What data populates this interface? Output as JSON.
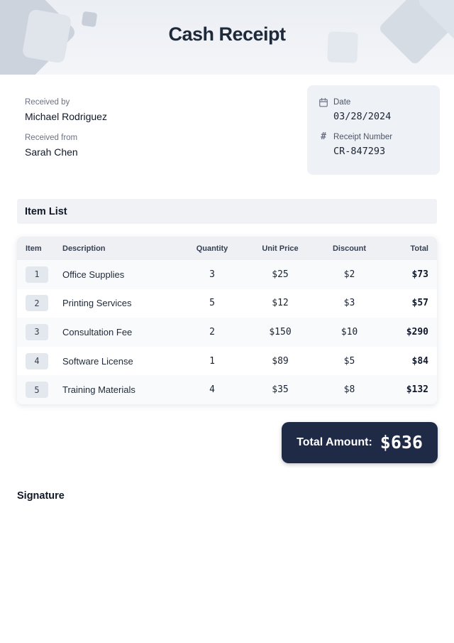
{
  "header": {
    "title": "Cash Receipt"
  },
  "info": {
    "received_by_label": "Received by",
    "received_by": "Michael Rodriguez",
    "received_from_label": "Received from",
    "received_from": "Sarah Chen",
    "date_label": "Date",
    "date": "03/28/2024",
    "receipt_number_label": "Receipt Number",
    "receipt_number": "CR-847293"
  },
  "item_list": {
    "section_title": "Item List",
    "columns": [
      "Item",
      "Description",
      "Quantity",
      "Unit Price",
      "Discount",
      "Total"
    ],
    "rows": [
      {
        "item": "1",
        "description": "Office Supplies",
        "quantity": "3",
        "unit_price": "$25",
        "discount": "$2",
        "total": "$73"
      },
      {
        "item": "2",
        "description": "Printing Services",
        "quantity": "5",
        "unit_price": "$12",
        "discount": "$3",
        "total": "$57"
      },
      {
        "item": "3",
        "description": "Consultation Fee",
        "quantity": "2",
        "unit_price": "$150",
        "discount": "$10",
        "total": "$290"
      },
      {
        "item": "4",
        "description": "Software License",
        "quantity": "1",
        "unit_price": "$89",
        "discount": "$5",
        "total": "$84"
      },
      {
        "item": "5",
        "description": "Training Materials",
        "quantity": "4",
        "unit_price": "$35",
        "discount": "$8",
        "total": "$132"
      }
    ]
  },
  "summary": {
    "total_label": "Total Amount:",
    "total_value": "$636"
  },
  "signature": {
    "label": "Signature"
  },
  "colors": {
    "accent_navy": "#1f2b46",
    "header_band_bg": "#edeff4",
    "card_bg": "#eef1f6",
    "table_header_bg": "#eef0f4",
    "row_alt_bg": "#f8fafc",
    "badge_bg": "#e3e8ef"
  }
}
